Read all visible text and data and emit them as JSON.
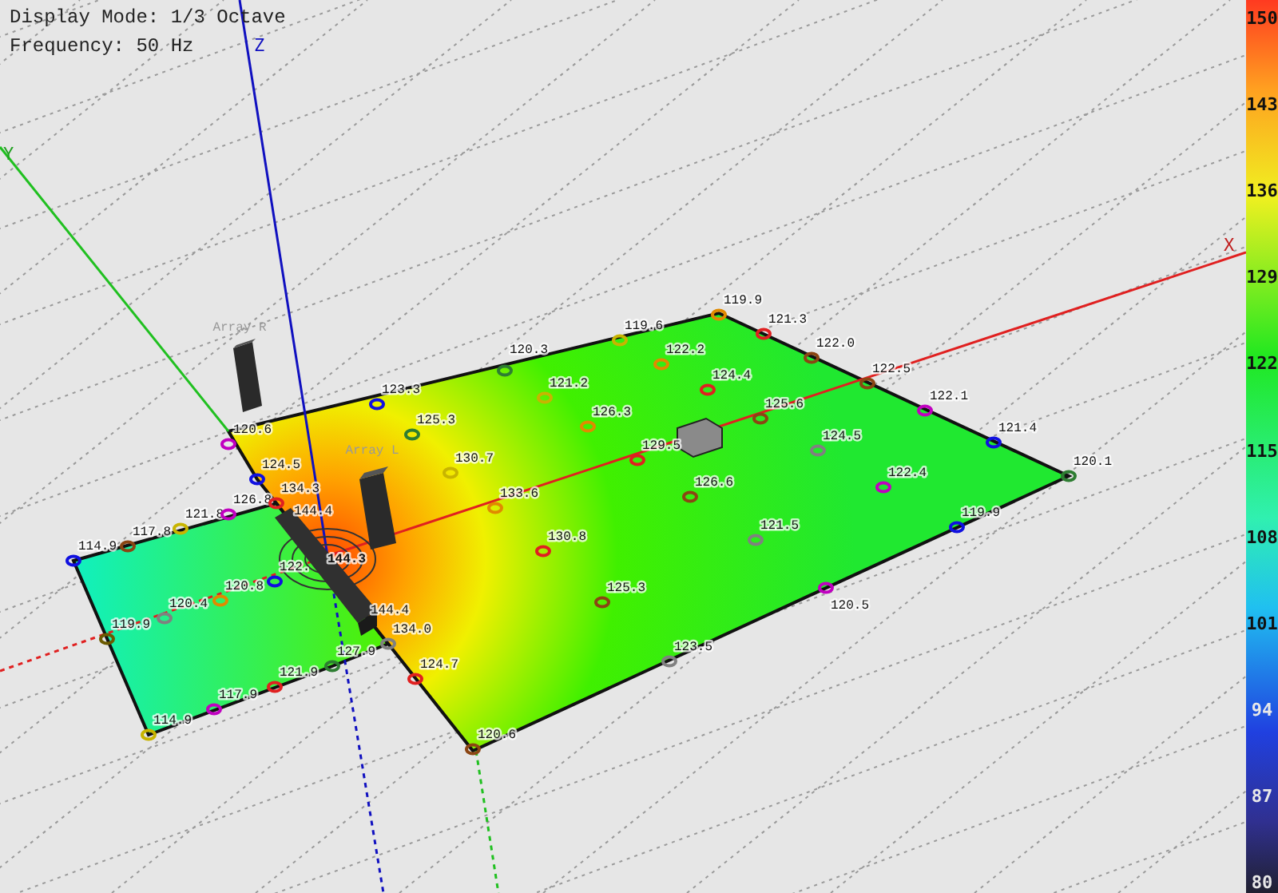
{
  "overlay": {
    "display_mode": "Display Mode: 1/3 Octave",
    "frequency": "Frequency: 50 Hz"
  },
  "axes": [
    {
      "label": "Z"
    },
    {
      "label": "Y"
    },
    {
      "label": "X"
    }
  ],
  "arrays": [
    {
      "label": "Array R"
    },
    {
      "label": "Array L"
    }
  ],
  "points": [
    {
      "value": "120.3",
      "color": "#2e7d32"
    },
    {
      "value": "119.6",
      "color": "#c8b400"
    },
    {
      "value": "119.9",
      "color": "#e08a00"
    },
    {
      "value": "121.3",
      "color": "#e02020"
    },
    {
      "value": "122.0",
      "color": "#8b4513"
    },
    {
      "value": "122.5",
      "color": "#8b4513"
    },
    {
      "value": "122.1",
      "color": "#c000c0"
    },
    {
      "value": "121.4",
      "color": "#1010e0"
    },
    {
      "value": "120.1",
      "color": "#2e7d32"
    },
    {
      "value": "119.9",
      "color": "#1010e0"
    },
    {
      "value": "120.5",
      "color": "#c000c0"
    },
    {
      "value": "123.5",
      "color": "#808080"
    },
    {
      "value": "120.6",
      "color": "#8b4513"
    },
    {
      "value": "124.7",
      "color": "#e02020"
    },
    {
      "value": "134.0",
      "color": "#808080"
    },
    {
      "value": "127.9",
      "color": "#2e7d32"
    },
    {
      "value": "121.9",
      "color": "#e02020"
    },
    {
      "value": "117.9",
      "color": "#c000c0"
    },
    {
      "value": "114.9",
      "color": "#c8b400"
    },
    {
      "value": "119.9",
      "color": "#6b5a00"
    },
    {
      "value": "120.4",
      "color": "#808080"
    },
    {
      "value": "120.8",
      "color": "#e08a00"
    },
    {
      "value": "122.",
      "color": "#1010e0"
    },
    {
      "value": "114.9",
      "color": "#1010e0"
    },
    {
      "value": "117.8",
      "color": "#8b4513"
    },
    {
      "value": "121.8",
      "color": "#c8b400"
    },
    {
      "value": "126.8",
      "color": "#c000c0"
    },
    {
      "value": "134.3",
      "color": "#e02020"
    },
    {
      "value": "124.5",
      "color": "#1010e0"
    },
    {
      "value": "120.6",
      "color": "#c000c0"
    },
    {
      "value": "123.3",
      "color": "#1010e0"
    },
    {
      "value": "125.3",
      "color": "#2e7d32"
    },
    {
      "value": "130.7",
      "color": "#c8b400"
    },
    {
      "value": "133.6",
      "color": "#e08a00"
    },
    {
      "value": "130.8",
      "color": "#e02020"
    },
    {
      "value": "125.3",
      "color": "#8b4513"
    },
    {
      "value": "121.2",
      "color": "#c8b400"
    },
    {
      "value": "126.3",
      "color": "#e08a00"
    },
    {
      "value": "122.2",
      "color": "#e08a00"
    },
    {
      "value": "124.4",
      "color": "#e02020"
    },
    {
      "value": "129.5",
      "color": "#e02020"
    },
    {
      "value": "125.6",
      "color": "#8b4513"
    },
    {
      "value": "124.5",
      "color": "#808080"
    },
    {
      "value": "126.6",
      "color": "#8b4513"
    },
    {
      "value": "122.4",
      "color": "#c000c0"
    },
    {
      "value": "121.5",
      "color": "#808080"
    }
  ],
  "source_levels": [
    {
      "value": "144.4"
    },
    {
      "value": "144.3"
    },
    {
      "value": "144.4"
    }
  ],
  "color_scale": {
    "ticks": [
      "150",
      "143",
      "136",
      "129",
      "122",
      "115",
      "108",
      "101",
      "94",
      "87",
      "80"
    ]
  }
}
